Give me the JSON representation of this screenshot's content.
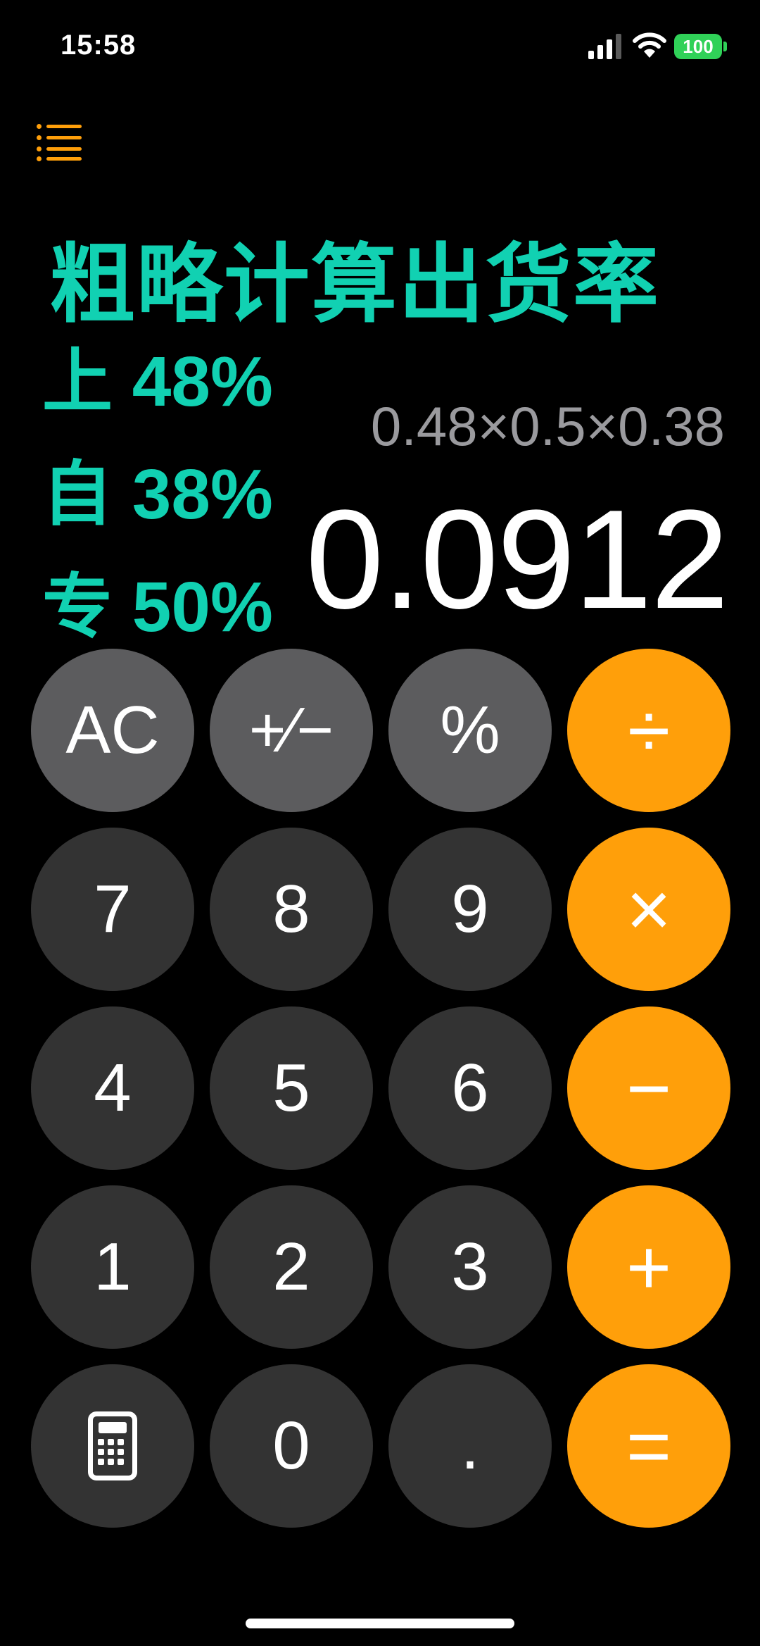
{
  "status_bar": {
    "time": "15:58",
    "battery": "100",
    "battery_color": "#30d158"
  },
  "header": {
    "menu_icon": "list-icon",
    "menu_color": "#ff9f0a"
  },
  "annotation": {
    "title": "粗略计算出货率",
    "lines": [
      "上 48%",
      "自 38%",
      "专 50%"
    ],
    "color": "#11d1b2"
  },
  "display": {
    "expression": "0.48×0.5×0.38",
    "result": "0.0912"
  },
  "keypad": {
    "rows": [
      [
        "AC",
        "+∕−",
        "%",
        "÷"
      ],
      [
        "7",
        "8",
        "9",
        "×"
      ],
      [
        "4",
        "5",
        "6",
        "−"
      ],
      [
        "1",
        "2",
        "3",
        "+"
      ],
      [
        "calculator-icon",
        "0",
        ".",
        "="
      ]
    ],
    "operator_color": "#ff9f0a",
    "function_color": "#5c5c5e",
    "digit_color": "#333333"
  }
}
